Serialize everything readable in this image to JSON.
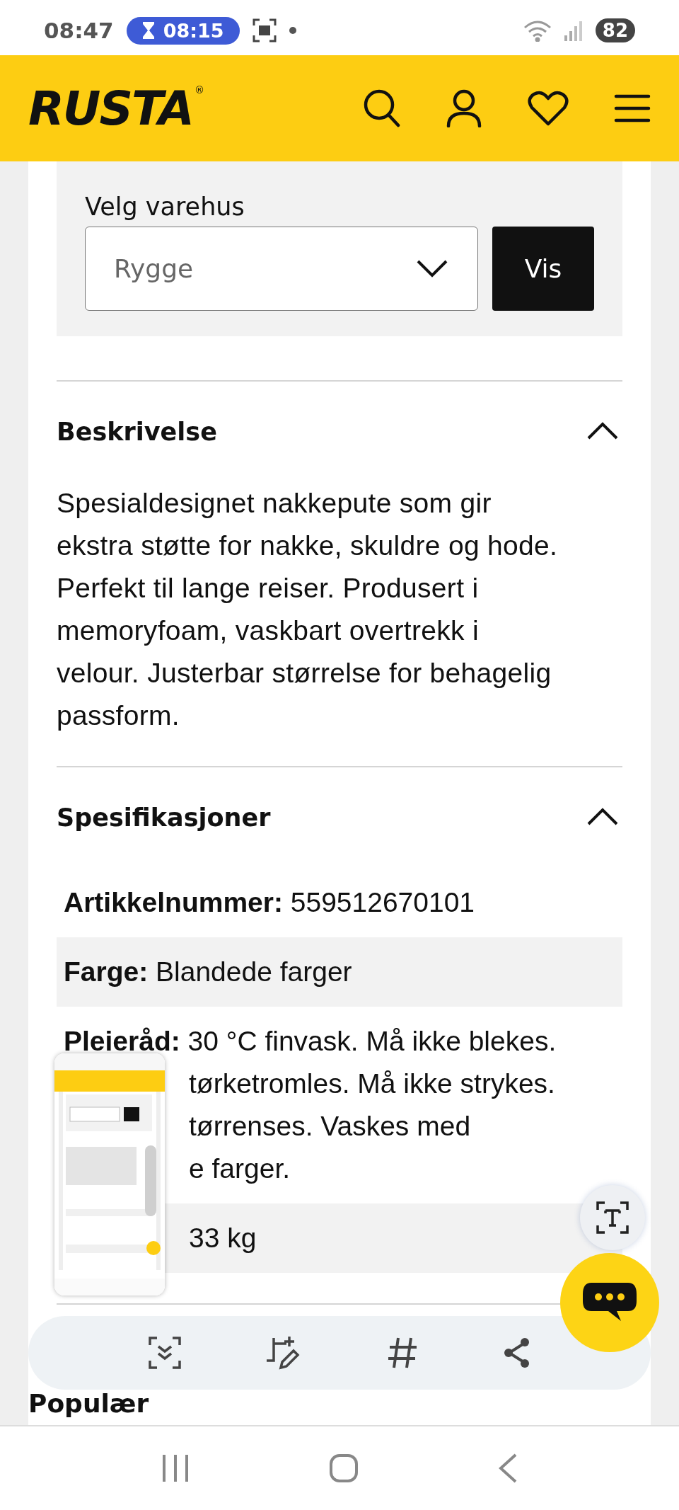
{
  "status_bar": {
    "time": "08:47",
    "timer": "08:15",
    "battery": "82"
  },
  "header": {
    "logo": "RUSTA",
    "logo_mark": "®"
  },
  "store": {
    "label": "Velg varehus",
    "value": "Rygge",
    "button": "Vis"
  },
  "sections": [
    {
      "kind": "text",
      "title": "Beskrivelse",
      "expanded": true,
      "text": "Spesialdesignet nakkepute som gir ekstra støtte for nakke, skuldre og hode. Perfekt til lange reiser. Produsert i memoryfoam, vaskbart overtrekk i velour. Justerbar størrelse for behagelig passform."
    },
    {
      "kind": "specs",
      "title": "Spesifikasjoner",
      "expanded": true,
      "rows": [
        {
          "label": "Artikkelnummer:",
          "value": "559512670101",
          "shaded": false
        },
        {
          "label": "Farge:",
          "value": "Blandede farger",
          "shaded": true
        },
        {
          "label": "Pleieråd:",
          "value": "30 °C finvask. Må ikke blekes.",
          "shaded": false,
          "lines": [
            "tørketromles. Må ikke strykes.",
            "tørrenses. Vaskes med",
            "e farger."
          ]
        },
        {
          "shaded": true,
          "lines": [
            "33 kg"
          ]
        }
      ]
    }
  ],
  "next_heading": "Populær"
}
